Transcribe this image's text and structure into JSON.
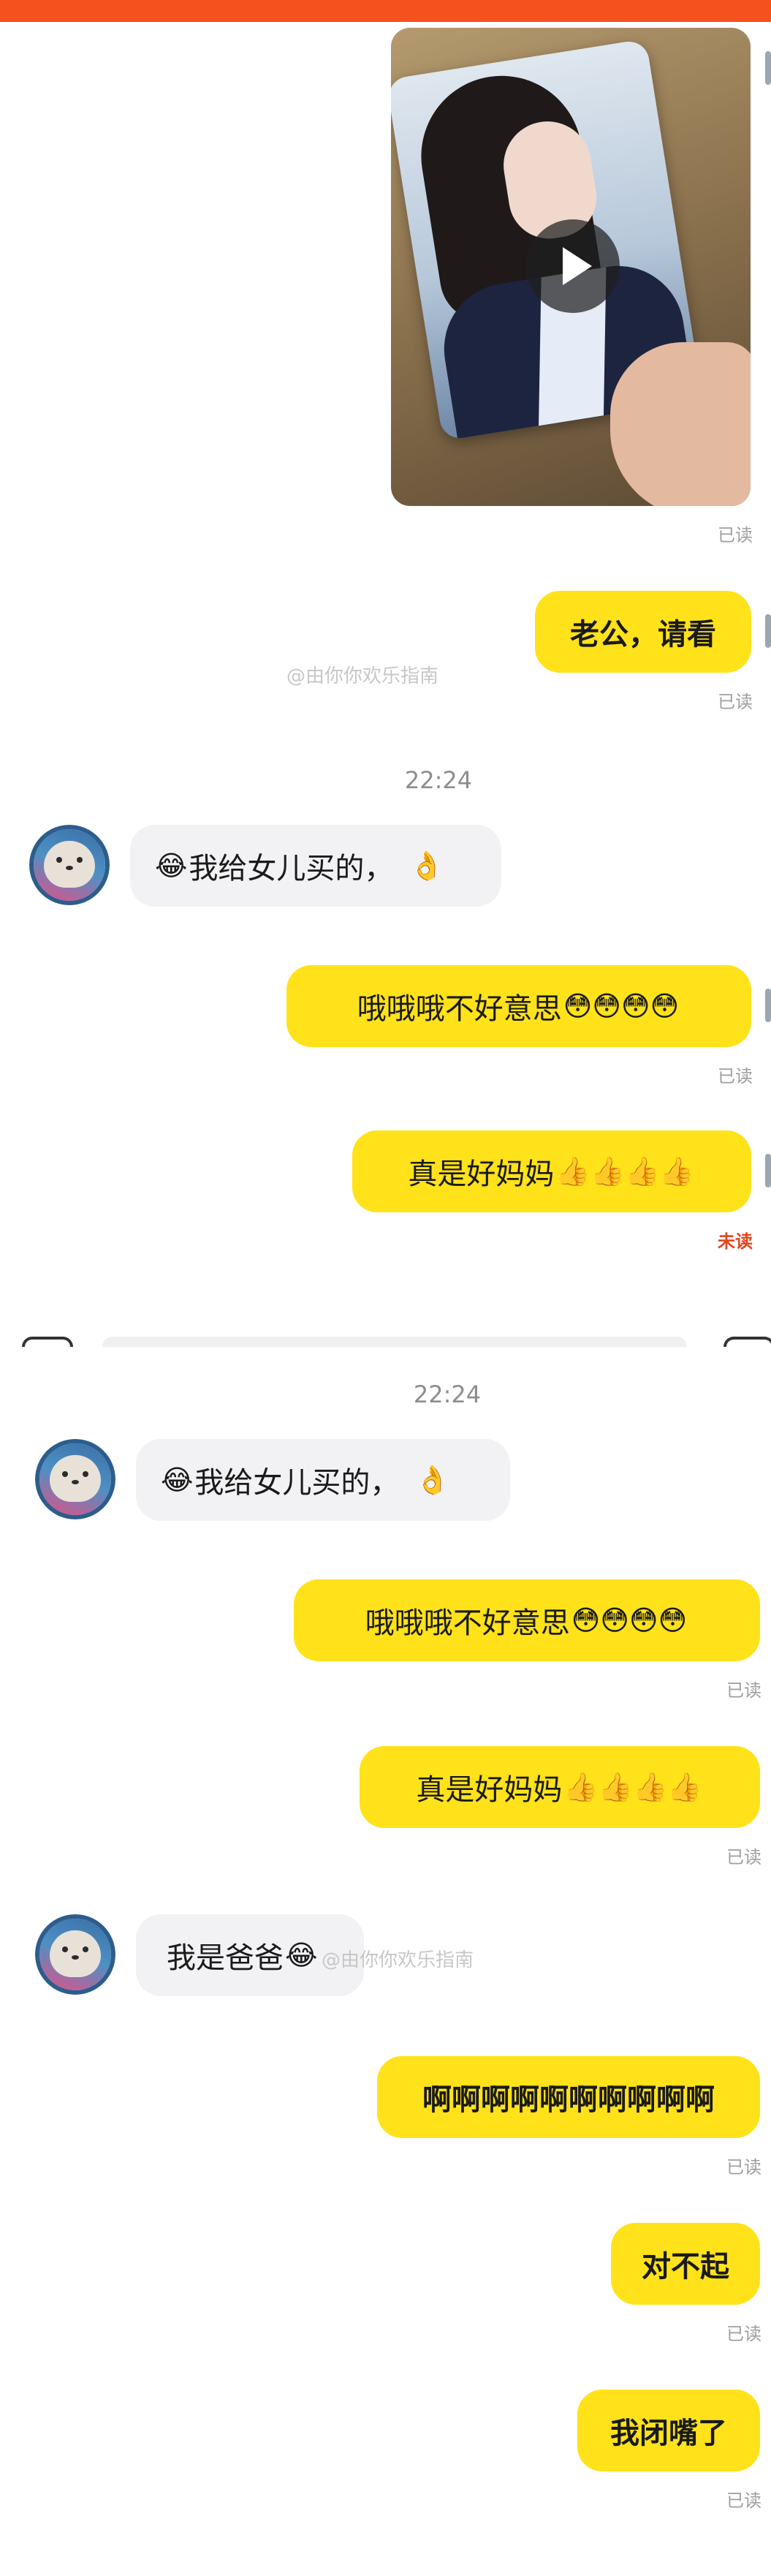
{
  "topbar": {
    "color": "#f4511e"
  },
  "video_message": {
    "play_icon": "play-icon",
    "status": "已读"
  },
  "watermark": "@由你你欢乐指南",
  "screenshot_1": {
    "messages": [
      {
        "side": "right",
        "text": "老公，请看",
        "status": "已读"
      },
      {
        "time": "22:24"
      },
      {
        "side": "left",
        "text": "我给女儿买的，",
        "emoji_prefix": "😂",
        "emoji_suffix": "👌"
      },
      {
        "side": "right",
        "text": "哦哦哦不好意思",
        "emoji_suffix": "😳😳😳😳",
        "status": "已读"
      },
      {
        "side": "right",
        "text": "真是好妈妈",
        "emoji_suffix": "👍👍👍👍",
        "status": "未读"
      }
    ]
  },
  "screenshot_2": {
    "messages": [
      {
        "time": "22:24"
      },
      {
        "side": "left",
        "text": "我给女儿买的，",
        "emoji_prefix": "😂",
        "emoji_suffix": "👌"
      },
      {
        "side": "right",
        "text": "哦哦哦不好意思",
        "emoji_suffix": "😳😳😳😳",
        "status": "已读"
      },
      {
        "side": "right",
        "text": "真是好妈妈",
        "emoji_suffix": "👍👍👍👍",
        "status": "已读"
      },
      {
        "side": "left",
        "text": "我是爸爸",
        "emoji_suffix": "😂"
      },
      {
        "side": "right",
        "text": "啊啊啊啊啊啊啊啊啊啊",
        "status": "已读"
      },
      {
        "side": "right",
        "text": "对不起",
        "status": "已读"
      },
      {
        "side": "right",
        "text": "我闭嘴了",
        "status": "已读"
      }
    ]
  },
  "colors": {
    "bubble_right": "#ffe21a",
    "bubble_left": "#f2f2f4",
    "unread": "#e4441d"
  }
}
